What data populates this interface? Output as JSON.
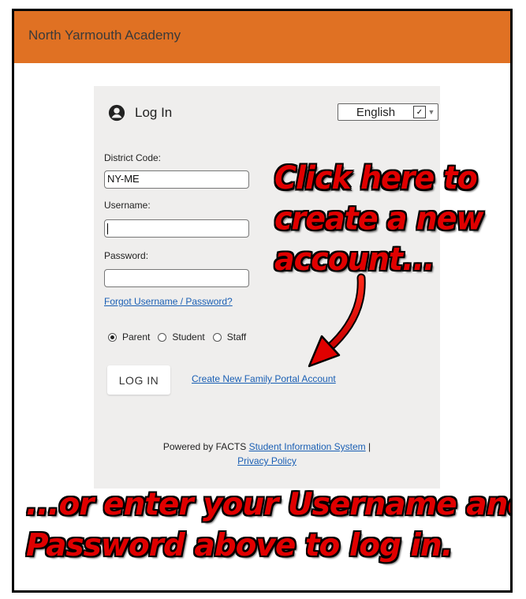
{
  "header": {
    "title": "North Yarmouth Academy"
  },
  "login": {
    "title": "Log In",
    "language": "English",
    "district_label": "District Code:",
    "district_value": "NY-ME",
    "username_label": "Username:",
    "username_value": "",
    "password_label": "Password:",
    "password_value": "",
    "forgot_link": "Forgot Username / Password?",
    "roles": [
      {
        "label": "Parent",
        "selected": true
      },
      {
        "label": "Student",
        "selected": false
      },
      {
        "label": "Staff",
        "selected": false
      }
    ],
    "login_button": "LOG IN",
    "create_link": "Create New Family Portal Account"
  },
  "footer": {
    "powered_by": "Powered by FACTS",
    "sis_link": "Student Information System",
    "separator": "|",
    "privacy_link": "Privacy Policy"
  },
  "annotations": {
    "callout_lines": [
      "Click here to",
      "create a new",
      "account..."
    ],
    "bottom_lines": [
      "...or enter your Username and",
      "Password above to log in."
    ]
  },
  "colors": {
    "header": "#e07123",
    "card": "#efeeed",
    "link": "#1a5fb4",
    "annotation": "#e00000"
  }
}
